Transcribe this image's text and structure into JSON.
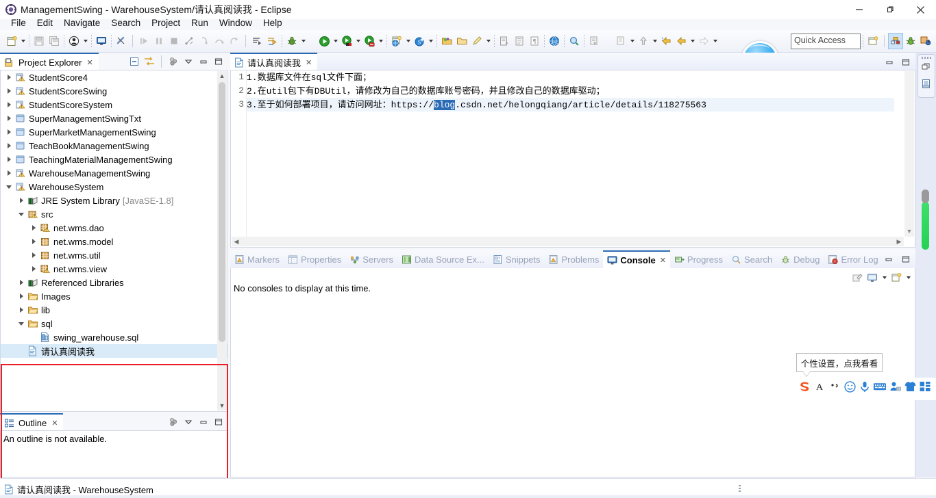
{
  "window": {
    "title": "ManagementSwing - WarehouseSystem/请认真阅读我 - Eclipse",
    "app_icon": "eclipse-icon",
    "minimize": "—",
    "maximize": "❐",
    "close": "✕"
  },
  "menu": {
    "items": [
      {
        "label": "File"
      },
      {
        "label": "Edit"
      },
      {
        "label": "Navigate"
      },
      {
        "label": "Search"
      },
      {
        "label": "Project"
      },
      {
        "label": "Run"
      },
      {
        "label": "Window"
      },
      {
        "label": "Help"
      }
    ]
  },
  "toolbar": {
    "quick_access_placeholder": "Quick Access",
    "groups": [
      {
        "icons": [
          "new-wizard-icon",
          "dropdown-arrow",
          "save-icon",
          "save-all-icon"
        ]
      },
      {
        "icons": [
          "person-icon",
          "dropdown-arrow"
        ]
      },
      {
        "icons": [
          "console-icon",
          "skip-breakpoints-icon"
        ]
      },
      {
        "icons": [
          "resume-icon",
          "suspend-icon",
          "terminate-icon",
          "disconnect-icon",
          "step-into-icon",
          "step-over-icon",
          "step-return-icon"
        ]
      },
      {
        "icons": [
          "next-annotation-icon",
          "last-edit-location-icon",
          "debug-icon",
          "dropdown-arrow"
        ]
      },
      {
        "icons": [
          "run-icon",
          "dropdown-arrow",
          "run-external-icon",
          "dropdown-arrow",
          "run-server-icon",
          "dropdown-arrow"
        ]
      },
      {
        "icons": [
          "new-java-project-icon",
          "dropdown-arrow",
          "new-spring-icon",
          "dropdown-arrow"
        ]
      },
      {
        "icons": [
          "open-type-icon",
          "open-task-icon",
          "new-annotation-icon",
          "dropdown-arrow"
        ]
      },
      {
        "icons": [
          "export-icon",
          "toggle-block-icon",
          "show-whitespace-icon"
        ]
      },
      {
        "icons": [
          "open-web-browser-icon",
          "search-icon",
          "pin-icon"
        ]
      },
      {
        "icons": [
          "previous-edit-icon",
          "dropdown-arrow",
          "back-up-icon",
          "dropdown-arrow",
          "back-history-icon",
          "back-arrow-icon",
          "dropdown-arrow",
          "forward-arrow-icon",
          "dropdown-arrow"
        ]
      }
    ],
    "perspective_icons": [
      "open-perspective-icon",
      "java-ee-perspective-icon",
      "debug-perspective-icon",
      "java-perspective-icon"
    ]
  },
  "project_explorer": {
    "tab_label": "Project Explorer",
    "tab_icon": "project-explorer-icon",
    "tab_close": "✕",
    "tools": [
      "collapse-all-icon",
      "link-with-editor-icon",
      "view-menu-icon",
      "minimize-icon",
      "maximize-icon"
    ],
    "nodes": [
      {
        "label": "StudentScore4",
        "icon": "java-project-icon",
        "twisty": "closed",
        "indent": 0
      },
      {
        "label": "StudentScoreSwing",
        "icon": "java-project-icon",
        "twisty": "closed",
        "indent": 0
      },
      {
        "label": "StudentScoreSystem",
        "icon": "java-project-icon",
        "twisty": "closed",
        "indent": 0
      },
      {
        "label": "SuperManagementSwingTxt",
        "icon": "folder-project-icon",
        "twisty": "closed",
        "indent": 0
      },
      {
        "label": "SuperMarketManagementSwing",
        "icon": "folder-project-icon",
        "twisty": "closed",
        "indent": 0
      },
      {
        "label": "TeachBookManagementSwing",
        "icon": "folder-project-icon",
        "twisty": "closed",
        "indent": 0
      },
      {
        "label": "TeachingMaterialManagementSwing",
        "icon": "folder-project-icon",
        "twisty": "closed",
        "indent": 0
      },
      {
        "label": "WarehouseManagementSwing",
        "icon": "java-project-icon",
        "twisty": "closed",
        "indent": 0
      },
      {
        "label": "WarehouseSystem",
        "icon": "java-project-icon",
        "twisty": "open",
        "indent": 0
      },
      {
        "label": "JRE System Library",
        "suffix": "[JavaSE-1.8]",
        "icon": "library-icon",
        "twisty": "closed",
        "indent": 1
      },
      {
        "label": "src",
        "icon": "source-folder-icon",
        "twisty": "open",
        "indent": 1
      },
      {
        "label": "net.wms.dao",
        "icon": "package-warn-icon",
        "twisty": "closed",
        "indent": 2
      },
      {
        "label": "net.wms.model",
        "icon": "package-icon",
        "twisty": "closed",
        "indent": 2
      },
      {
        "label": "net.wms.util",
        "icon": "package-icon",
        "twisty": "closed",
        "indent": 2
      },
      {
        "label": "net.wms.view",
        "icon": "package-warn-icon",
        "twisty": "closed",
        "indent": 2
      },
      {
        "label": "Referenced Libraries",
        "icon": "library-icon",
        "twisty": "closed",
        "indent": 1
      },
      {
        "label": "Images",
        "icon": "folder-icon",
        "twisty": "closed",
        "indent": 1
      },
      {
        "label": "lib",
        "icon": "folder-icon",
        "twisty": "closed",
        "indent": 1
      },
      {
        "label": "sql",
        "icon": "folder-icon",
        "twisty": "open",
        "indent": 1
      },
      {
        "label": "swing_warehouse.sql",
        "icon": "sql-file-icon",
        "twisty": "none",
        "indent": 2
      },
      {
        "label": "请认真阅读我",
        "icon": "text-file-icon",
        "twisty": "none",
        "indent": 1,
        "selected": true
      }
    ]
  },
  "outline": {
    "tab_label": "Outline",
    "tab_icon": "outline-icon",
    "tab_close": "✕",
    "message": "An outline is not available.",
    "tools": [
      "view-menu-icon",
      "minimize-icon",
      "maximize-icon"
    ]
  },
  "editor": {
    "tab_label": "请认真阅读我",
    "tab_icon": "text-file-icon",
    "tab_close": "✕",
    "lines": [
      {
        "num": "1",
        "text": "1.数据库文件在sql文件下面；"
      },
      {
        "num": "2",
        "text": "2.在util包下有DBUtil，请修改为自己的数据库账号密码，并且修改自己的数据库驱动；"
      },
      {
        "num": "3",
        "prefix": "3.至于如何部署项目，请访问网址：https://",
        "selection": "blog",
        "suffix": ".csdn.net/helongqiang/article/details/118275563"
      }
    ],
    "controls": [
      "minimize-icon",
      "maximize-icon"
    ]
  },
  "bottom_panel": {
    "tabs": [
      {
        "label": "Markers",
        "icon": "markers-icon",
        "active": false
      },
      {
        "label": "Properties",
        "icon": "properties-icon",
        "active": false
      },
      {
        "label": "Servers",
        "icon": "servers-icon",
        "active": false
      },
      {
        "label": "Data Source Ex...",
        "icon": "data-source-icon",
        "active": false
      },
      {
        "label": "Snippets",
        "icon": "snippets-icon",
        "active": false
      },
      {
        "label": "Problems",
        "icon": "problems-icon",
        "active": false
      },
      {
        "label": "Console",
        "icon": "console-icon",
        "active": true,
        "close": "✕"
      },
      {
        "label": "Progress",
        "icon": "progress-icon",
        "active": false
      },
      {
        "label": "Search",
        "icon": "search-icon",
        "active": false
      },
      {
        "label": "Debug",
        "icon": "debug-icon",
        "active": false
      },
      {
        "label": "Error Log",
        "icon": "error-log-icon",
        "active": false
      }
    ],
    "message": "No consoles to display at this time.",
    "tools": [
      "clear-console-icon",
      "display-selected-console-icon",
      "dropdown-arrow",
      "open-console-icon",
      "dropdown-arrow"
    ],
    "controls": [
      "minimize-icon",
      "maximize-icon"
    ]
  },
  "fast_view": {
    "icons": [
      "restore-icon",
      "editor-icon"
    ]
  },
  "status_bar": {
    "icon": "text-file-icon",
    "text": "请认真阅读我 - WarehouseSystem"
  },
  "ime": {
    "tooltip": "个性设置，点我看看",
    "buttons": [
      {
        "name": "sogou-logo-icon",
        "glyph": "S"
      },
      {
        "name": "input-mode-icon",
        "glyph": "A"
      },
      {
        "name": "punctuation-icon",
        "glyph": "·,"
      },
      {
        "name": "emoji-icon",
        "glyph": "☺"
      },
      {
        "name": "voice-input-icon",
        "glyph": "🎤"
      },
      {
        "name": "soft-keyboard-icon",
        "glyph": "⌨"
      },
      {
        "name": "user-icon",
        "glyph": "👤"
      },
      {
        "name": "skin-icon",
        "glyph": "👕"
      },
      {
        "name": "toolbox-icon",
        "glyph": "▦"
      }
    ]
  },
  "colors": {
    "accent": "#2a6bb5",
    "selection": "#d9eaf9",
    "annotation_red": "#ee1c25",
    "ime_orange": "#f4511e",
    "ime_blue": "#2b7fd4",
    "scroll_green": "#24d155"
  }
}
